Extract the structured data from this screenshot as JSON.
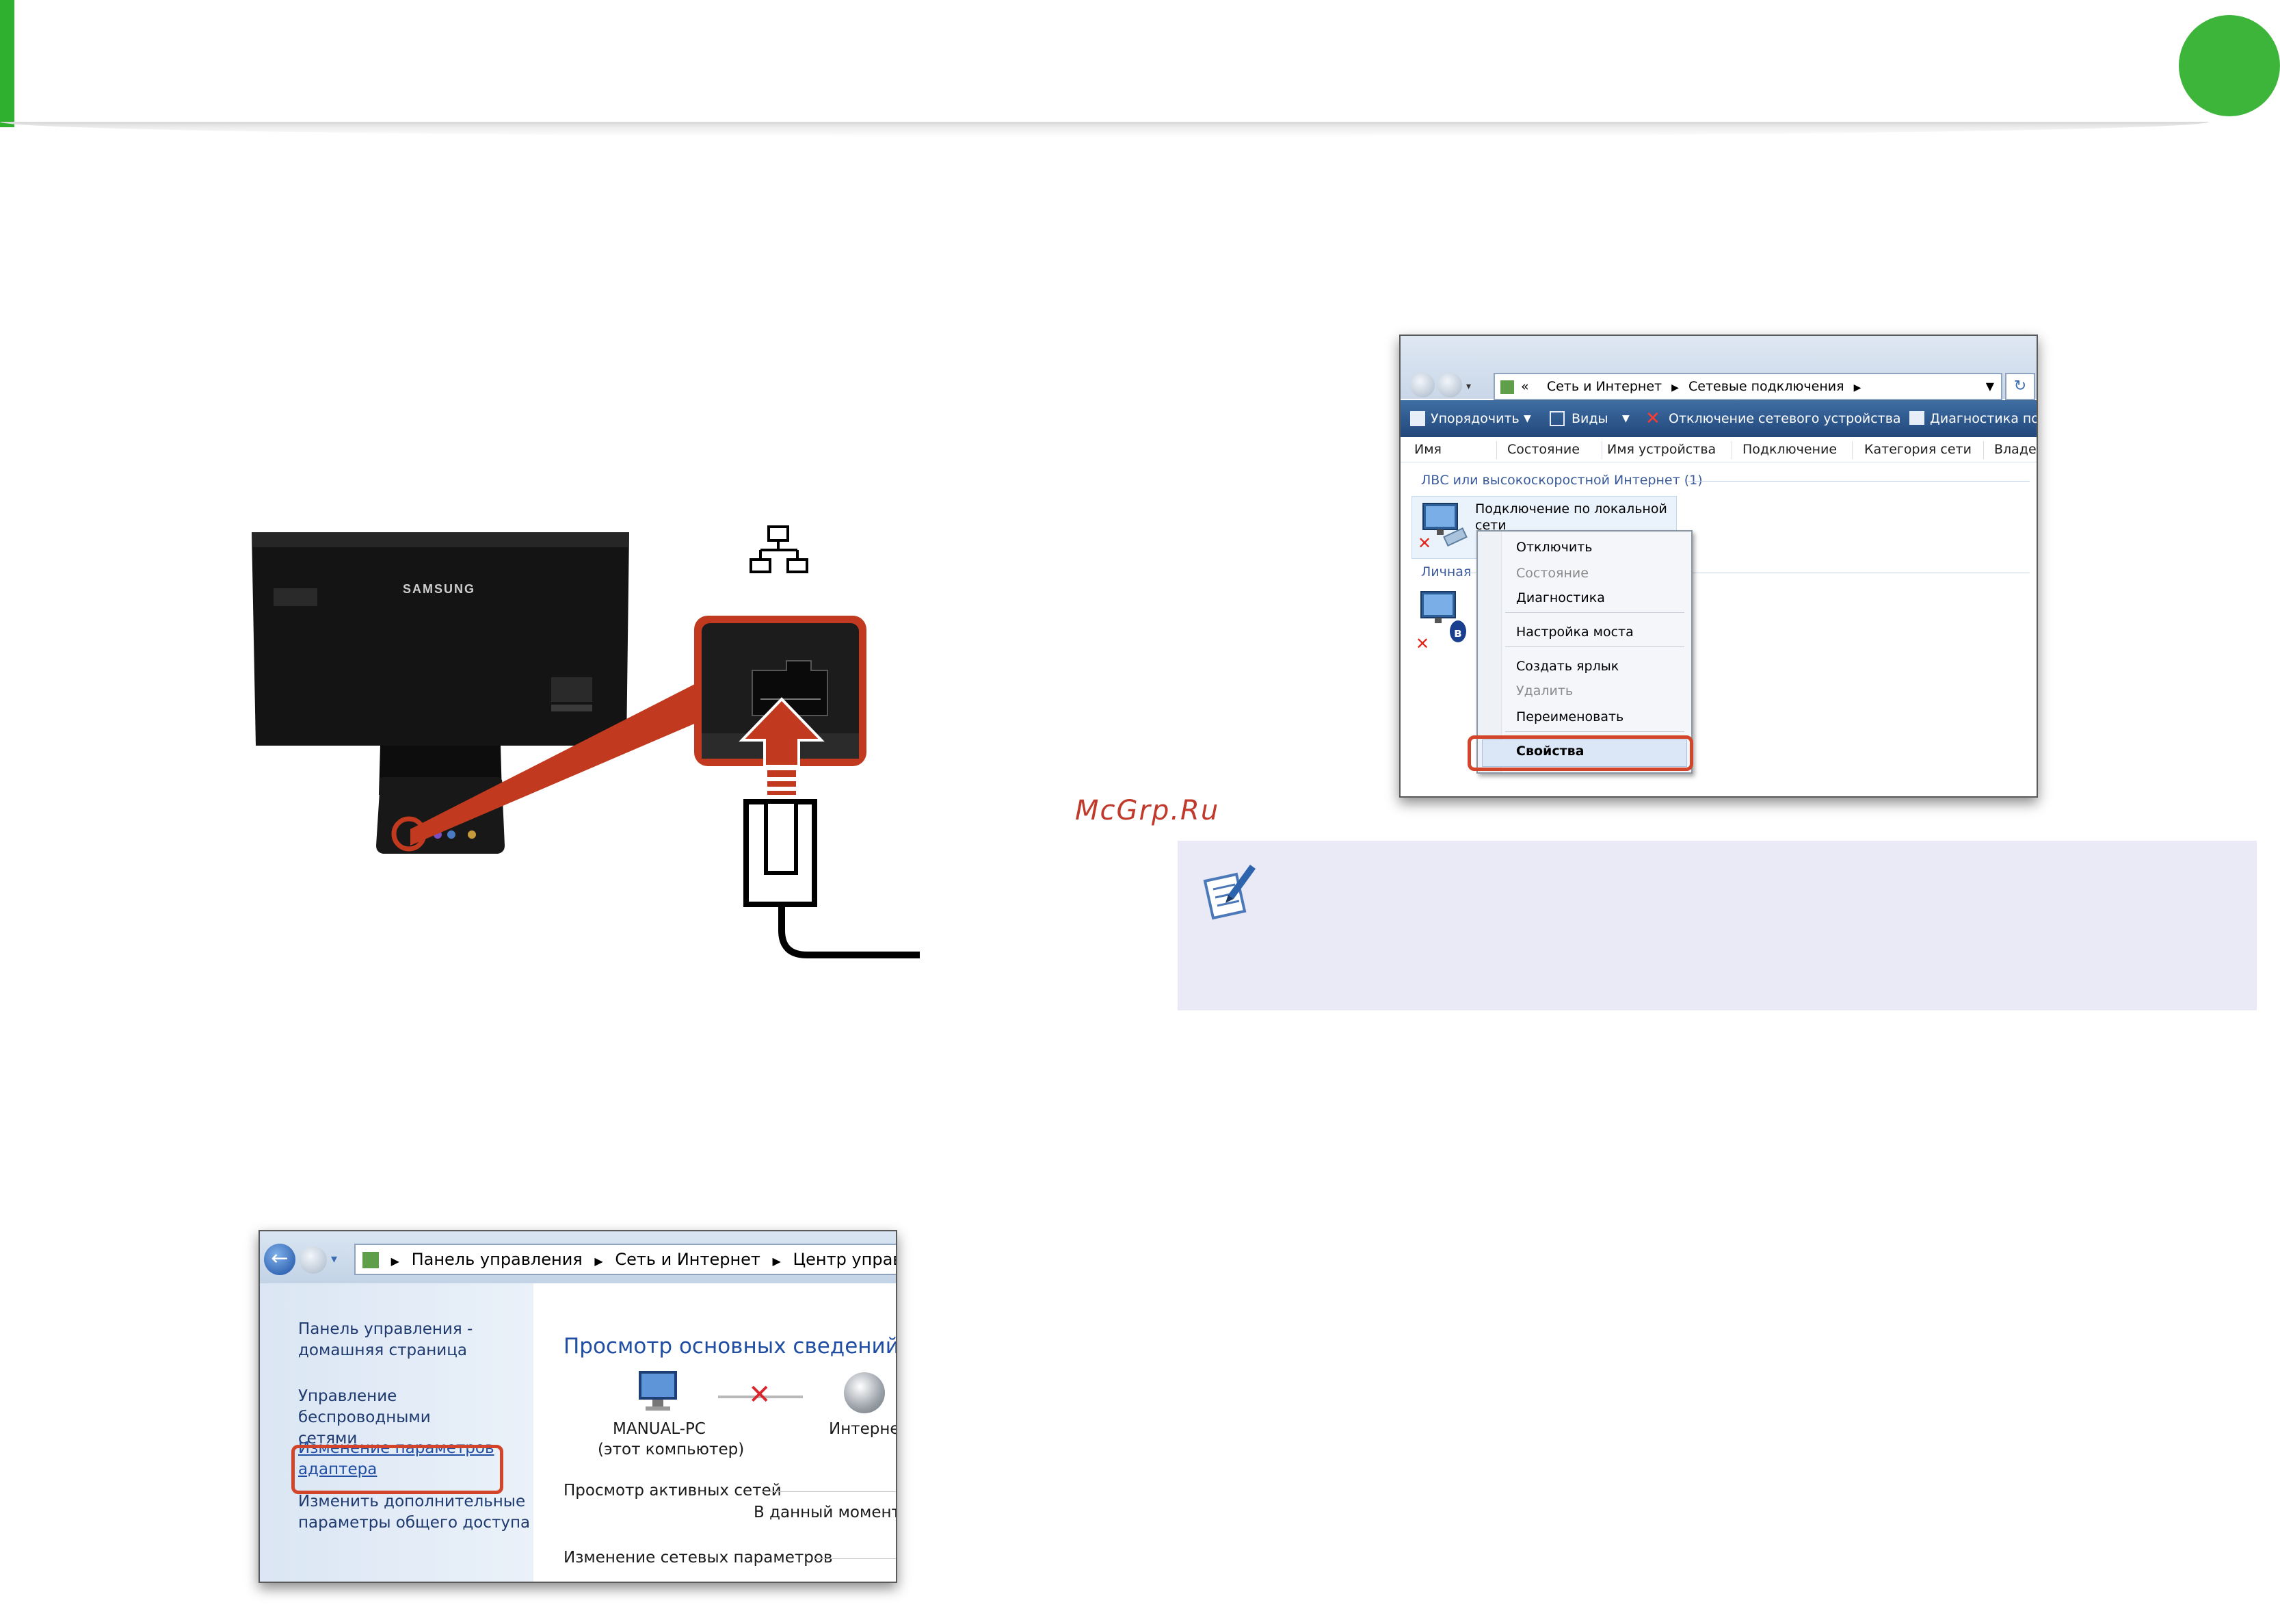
{
  "header": {
    "accent_color": "#2fb12f"
  },
  "watermark": "McGrp.Ru",
  "illustration": {
    "brand": "SAMSUNG",
    "lan_icon": "network-lan-icon",
    "highlight_color": "#d2452a"
  },
  "network_connections_window": {
    "address": {
      "prefix": "«",
      "crumbs": [
        "Сеть и Интернет",
        "Сетевые подключения"
      ]
    },
    "toolbar": {
      "organize": "Упорядочить",
      "views": "Виды",
      "disable": "Отключение сетевого устройства",
      "diagnose": "Диагностика по"
    },
    "columns": [
      "Имя",
      "Состояние",
      "Имя устройства",
      "Подключение",
      "Категория сети",
      "Владе"
    ],
    "group1": "ЛВС или высокоскоростной Интернет (1)",
    "connection_name_line1": "Подключение по локальной",
    "connection_name_line2": "сети",
    "group2": "Личная",
    "context_menu": [
      {
        "label": "Отключить",
        "disabled": false
      },
      {
        "label": "Состояние",
        "disabled": true
      },
      {
        "label": "Диагностика",
        "disabled": false
      },
      {
        "label": "Настройка моста",
        "disabled": false
      },
      {
        "label": "Создать ярлык",
        "disabled": false
      },
      {
        "label": "Удалить",
        "disabled": true
      },
      {
        "label": "Переименовать",
        "disabled": false
      },
      {
        "label": "Свойства",
        "disabled": false
      }
    ]
  },
  "network_center_window": {
    "address": [
      "Панель управления",
      "Сеть и Интернет",
      "Центр управления с"
    ],
    "left_pane": {
      "home_line1": "Панель управления -",
      "home_line2": "домашняя страница",
      "wireless_line1": "Управление беспроводными",
      "wireless_line2": "сетями",
      "adapter_line1": "Изменение параметров",
      "adapter_line2": "адаптера",
      "sharing_line1": "Изменить дополнительные",
      "sharing_line2": "параметры общего доступа"
    },
    "main_title": "Просмотр основных сведений о с",
    "computer_name": "MANUAL-PC",
    "computer_note": "(этот компьютер)",
    "internet_label": "Интерне",
    "active_networks": "Просмотр активных сетей",
    "current_moment": "В данный момент",
    "change_settings": "Изменение сетевых параметров"
  }
}
